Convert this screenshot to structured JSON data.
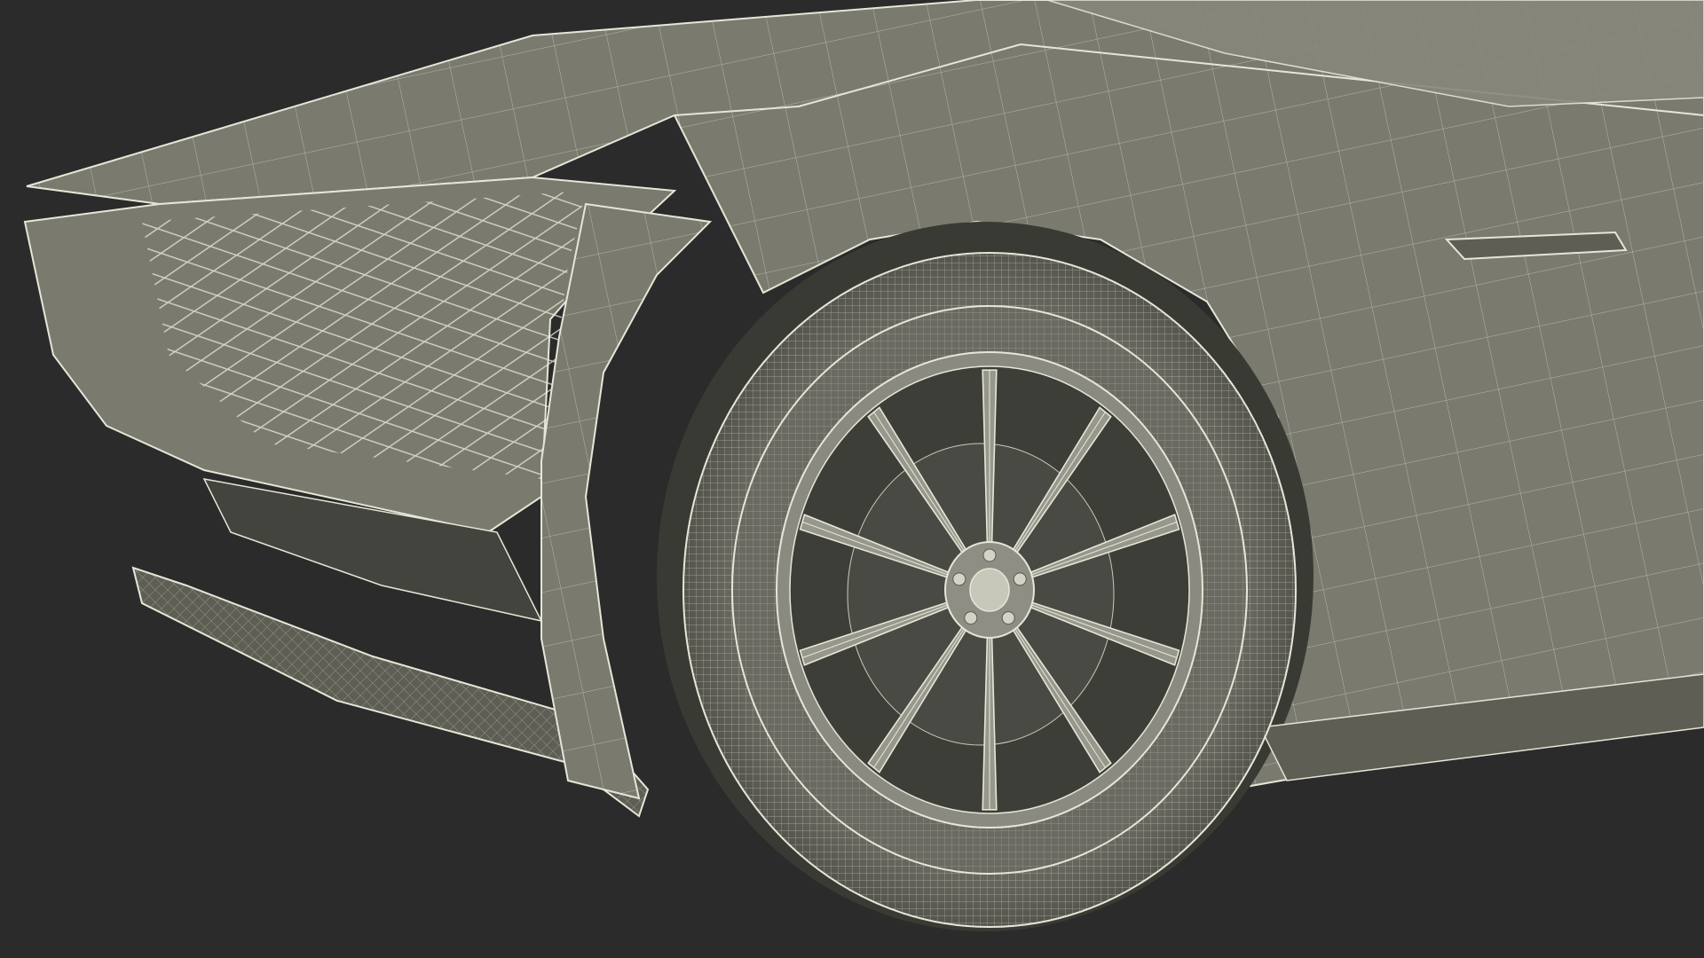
{
  "scene": {
    "subject": "car-front-wheel-wireframe",
    "colors": {
      "background": "#2b2b2b",
      "surface": "#7a7a6e",
      "surface_dark": "#5e5e55",
      "surface_shadow": "#44443e",
      "wire": "#e6e6d8",
      "wire_soft": "#c9c9bb",
      "tire": "#6a6a62",
      "rim": "#8a8a80",
      "rim_dark": "#3e3e39"
    },
    "wheel": {
      "spoke_count": 10,
      "lug_nut_count": 5
    }
  }
}
